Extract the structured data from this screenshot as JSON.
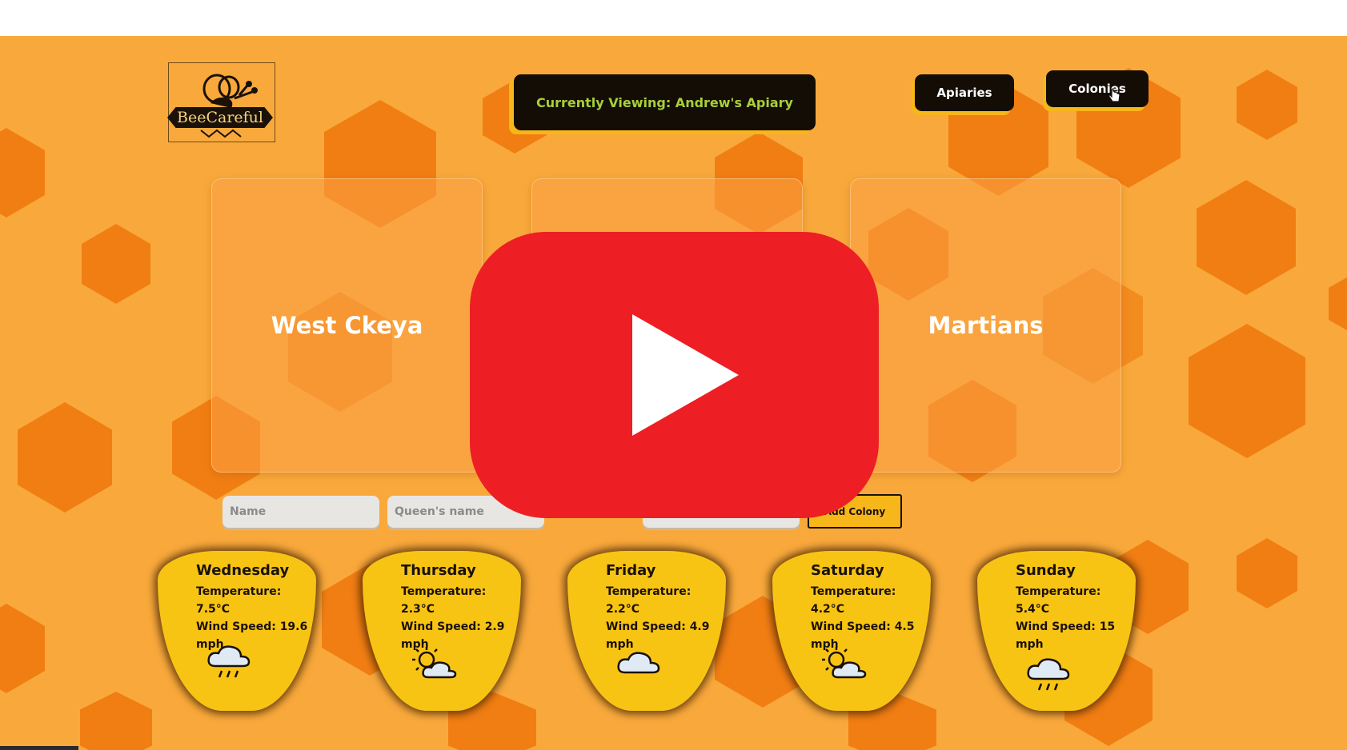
{
  "app": {
    "logo_text": "BeeCareful",
    "banner": "Currently Viewing: Andrew's Apiary"
  },
  "nav": {
    "apiaries": "Apiaries",
    "colonies": "Colonies"
  },
  "colonies": [
    {
      "name": "West Ckeya"
    },
    {
      "name": ""
    },
    {
      "name": "Martians"
    }
  ],
  "form": {
    "name_placeholder": "Name",
    "queen_placeholder": "Queen's name",
    "third_placeholder": "",
    "add_button": "Add Colony"
  },
  "weather": [
    {
      "day": "Wednesday",
      "temp": "Temperature: 7.5°C",
      "wind": "Wind Speed: 19.6 mph",
      "icon": "rain-cloud-icon"
    },
    {
      "day": "Thursday",
      "temp": "Temperature: 2.3°C",
      "wind": "Wind Speed: 2.9 mph",
      "icon": "partly-sunny-icon"
    },
    {
      "day": "Friday",
      "temp": "Temperature: 2.2°C",
      "wind": "Wind Speed: 4.9 mph",
      "icon": "cloud-icon"
    },
    {
      "day": "Saturday",
      "temp": "Temperature: 4.2°C",
      "wind": "Wind Speed: 4.5 mph",
      "icon": "partly-sunny-icon"
    },
    {
      "day": "Sunday",
      "temp": "Temperature: 5.4°C",
      "wind": "Wind Speed: 15 mph",
      "icon": "rain-cloud-icon"
    }
  ],
  "colors": {
    "background": "#f9a93b",
    "hexagon": "#f17e13",
    "banner_text": "#a8cf3b",
    "weather_card": "#f8c414",
    "play_button": "#ed1f24"
  },
  "overlay": {
    "icon": "youtube-play-icon"
  }
}
